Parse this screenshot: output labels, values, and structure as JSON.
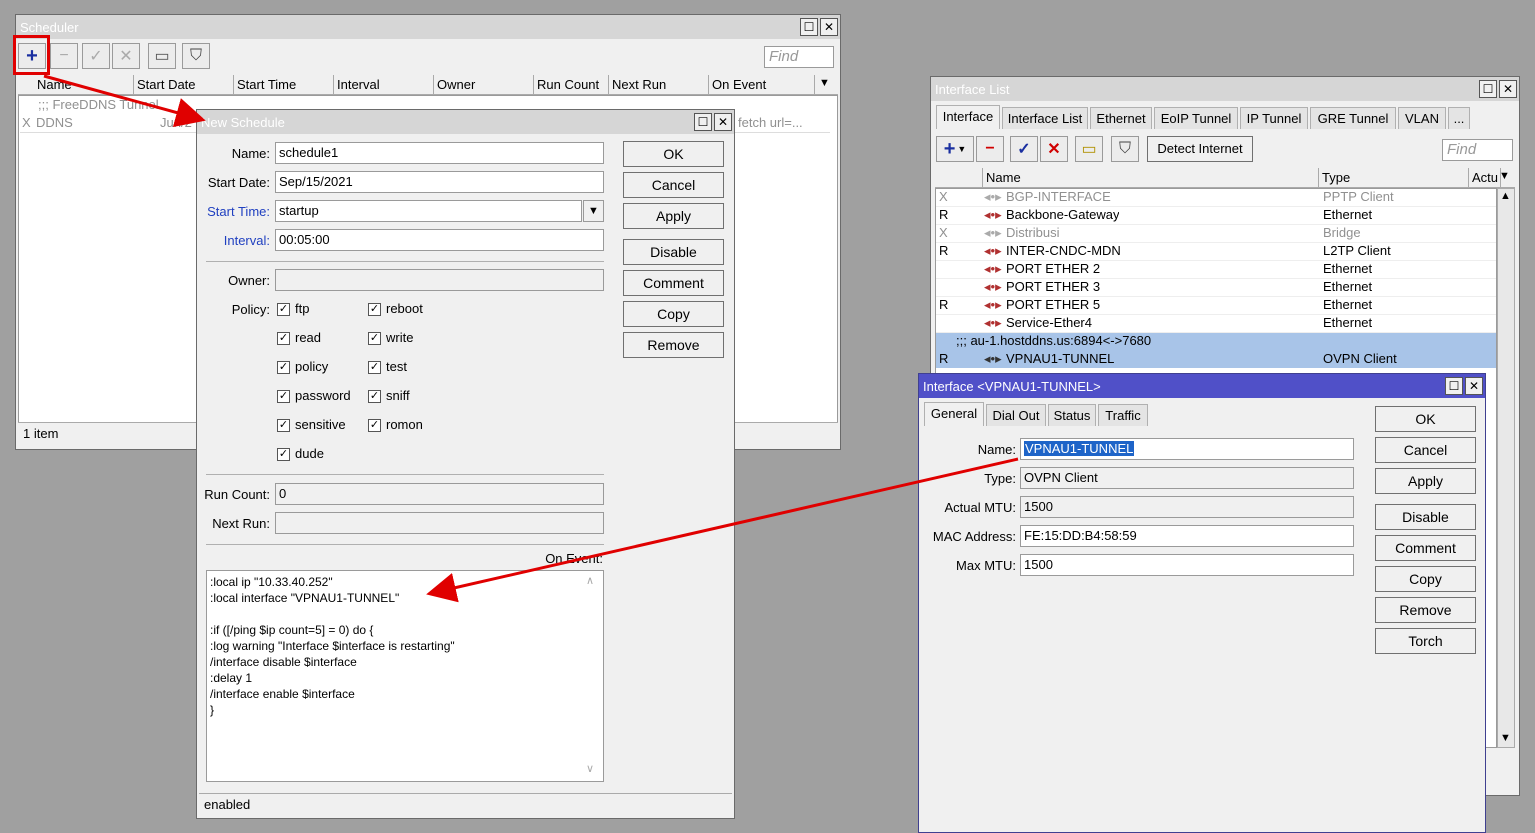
{
  "scheduler": {
    "title": "Scheduler",
    "find_placeholder": "Find",
    "columns": [
      "Name",
      "Start Date",
      "Start Time",
      "Interval",
      "Owner",
      "Run Count",
      "Next Run",
      "On Event"
    ],
    "comment_row": ";;; FreeDDNS Tunnel",
    "row_flag": "X",
    "row_name": "DDNS",
    "row_date": "Jun/2",
    "row_event": "fetch url=...",
    "status": "1 item"
  },
  "new_schedule": {
    "title": "New Schedule",
    "labels": {
      "name": "Name:",
      "start_date": "Start Date:",
      "start_time": "Start Time:",
      "interval": "Interval:",
      "owner": "Owner:",
      "policy": "Policy:",
      "run_count": "Run Count:",
      "next_run": "Next Run:",
      "on_event": "On Event:"
    },
    "values": {
      "name": "schedule1",
      "start_date": "Sep/15/2021",
      "start_time": "startup",
      "interval": "00:05:00",
      "owner": "",
      "run_count": "0",
      "next_run": ""
    },
    "policies_left": [
      "ftp",
      "read",
      "policy",
      "password",
      "sensitive",
      "dude"
    ],
    "policies_right": [
      "reboot",
      "write",
      "test",
      "sniff",
      "romon"
    ],
    "buttons": [
      "OK",
      "Cancel",
      "Apply",
      "Disable",
      "Comment",
      "Copy",
      "Remove"
    ],
    "script": ":local ip \"10.33.40.252\"\n:local interface \"VPNAU1-TUNNEL\"\n\n:if ([/ping $ip count=5] = 0) do {\n:log warning \"Interface $interface is restarting\"\n/interface disable $interface\n:delay 1\n/interface enable $interface\n}",
    "status": "enabled"
  },
  "interface_list": {
    "title": "Interface List",
    "tabs": [
      "Interface",
      "Interface List",
      "Ethernet",
      "EoIP Tunnel",
      "IP Tunnel",
      "GRE Tunnel",
      "VLAN",
      "..."
    ],
    "detect_button": "Detect Internet",
    "find_placeholder": "Find",
    "columns": [
      "Name",
      "Type",
      "Actu"
    ],
    "rows": [
      {
        "flag": "X",
        "name": "BGP-INTERFACE",
        "type": "PPTP Client",
        "disabled": true
      },
      {
        "flag": "R",
        "name": "Backbone-Gateway",
        "type": "Ethernet",
        "disabled": false
      },
      {
        "flag": "X",
        "name": "Distribusi",
        "type": "Bridge",
        "disabled": true
      },
      {
        "flag": "R",
        "name": "INTER-CNDC-MDN",
        "type": "L2TP Client",
        "disabled": false
      },
      {
        "flag": "",
        "name": "PORT ETHER 2",
        "type": "Ethernet",
        "disabled": false
      },
      {
        "flag": "",
        "name": "PORT ETHER 3",
        "type": "Ethernet",
        "disabled": false
      },
      {
        "flag": "R",
        "name": "PORT ETHER 5",
        "type": "Ethernet",
        "disabled": false
      },
      {
        "flag": "",
        "name": "Service-Ether4",
        "type": "Ethernet",
        "disabled": false
      }
    ],
    "comment_row": ";;; au-1.hostddns.us:6894<->7680",
    "selected_row": {
      "flag": "R",
      "name": "VPNAU1-TUNNEL",
      "type": "OVPN Client"
    }
  },
  "interface_dialog": {
    "title": "Interface <VPNAU1-TUNNEL>",
    "tabs": [
      "General",
      "Dial Out",
      "Status",
      "Traffic"
    ],
    "labels": {
      "name": "Name:",
      "type": "Type:",
      "actual_mtu": "Actual MTU:",
      "mac": "MAC Address:",
      "max_mtu": "Max MTU:"
    },
    "values": {
      "name": "VPNAU1-TUNNEL",
      "type": "OVPN Client",
      "actual_mtu": "1500",
      "mac": "FE:15:DD:B4:58:59",
      "max_mtu": "1500"
    },
    "buttons": [
      "OK",
      "Cancel",
      "Apply",
      "Disable",
      "Comment",
      "Copy",
      "Remove",
      "Torch"
    ]
  },
  "colors": {
    "annotation": "#e00000",
    "active_title": "#5050c8",
    "selection": "#a8c4e8"
  }
}
